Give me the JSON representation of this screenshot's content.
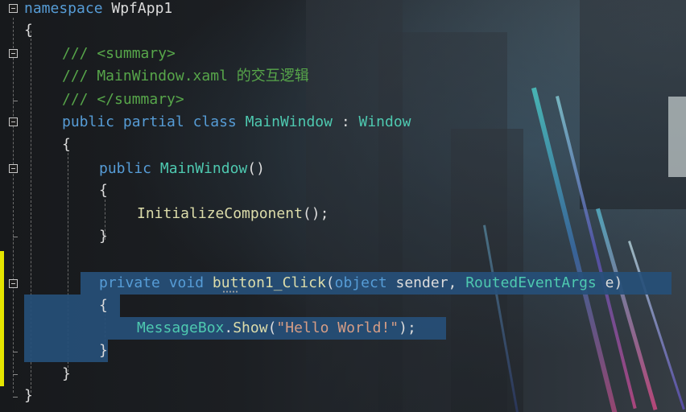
{
  "editor": {
    "lines": {
      "l1": {
        "kw1": "namespace",
        "name": " WpfApp1"
      },
      "l2": {
        "brace": "{"
      },
      "l3": {
        "cmt": "/// <summary>"
      },
      "l4": {
        "cmt": "/// MainWindow.xaml 的交互逻辑"
      },
      "l5": {
        "cmt": "/// </summary>"
      },
      "l6": {
        "kw1": "public",
        "kw2": "partial",
        "kw3": "class",
        "type1": "MainWindow",
        "sep": " : ",
        "type2": "Window"
      },
      "l7": {
        "brace": "{"
      },
      "l8": {
        "kw1": "public",
        "type1": "MainWindow",
        "paren": "()"
      },
      "l9": {
        "brace": "{"
      },
      "l10": {
        "method": "InitializeComponent",
        "rest": "();"
      },
      "l11": {
        "brace": "}"
      },
      "l12": {
        "kw1": "private",
        "kw2": "void",
        "method": "button1_Click",
        "p1": "(",
        "kw3": "object",
        "a1": " sender, ",
        "type1": "RoutedEventArgs",
        "a2": " e)"
      },
      "l13": {
        "brace": "{"
      },
      "l14": {
        "type1": "MessageBox",
        "dot": ".",
        "method": "Show",
        "p1": "(",
        "str": "\"Hello World!\"",
        "p2": ");"
      },
      "l15": {
        "brace": "}"
      },
      "l16": {
        "brace": "}"
      },
      "l17": {
        "brace": "}"
      }
    },
    "colors": {
      "keyword": "#569cd6",
      "type": "#4ec9b0",
      "comment": "#57a64a",
      "string": "#d69d85",
      "method": "#dcdcaa",
      "text": "#dcdcdc",
      "selection": "#264f78",
      "change_marker": "#e5e500"
    }
  }
}
